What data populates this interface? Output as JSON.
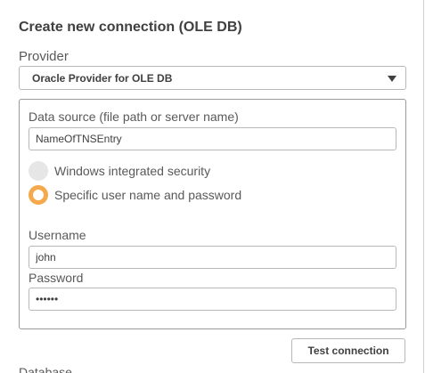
{
  "dialog": {
    "title": "Create new connection (OLE DB)"
  },
  "provider": {
    "label": "Provider",
    "selected": "Oracle Provider for OLE DB"
  },
  "data_source": {
    "label": "Data source (file path or server name)",
    "value": "NameOfTNSEntry"
  },
  "security": {
    "options": [
      {
        "label": "Windows integrated security",
        "selected": false
      },
      {
        "label": "Specific user name and password",
        "selected": true
      }
    ],
    "selected_color": "#f5a94c"
  },
  "username": {
    "label": "Username",
    "value": "john"
  },
  "password": {
    "label": "Password",
    "value": "••••••"
  },
  "test_connection": {
    "label": "Test connection"
  },
  "database": {
    "label": "Database"
  }
}
